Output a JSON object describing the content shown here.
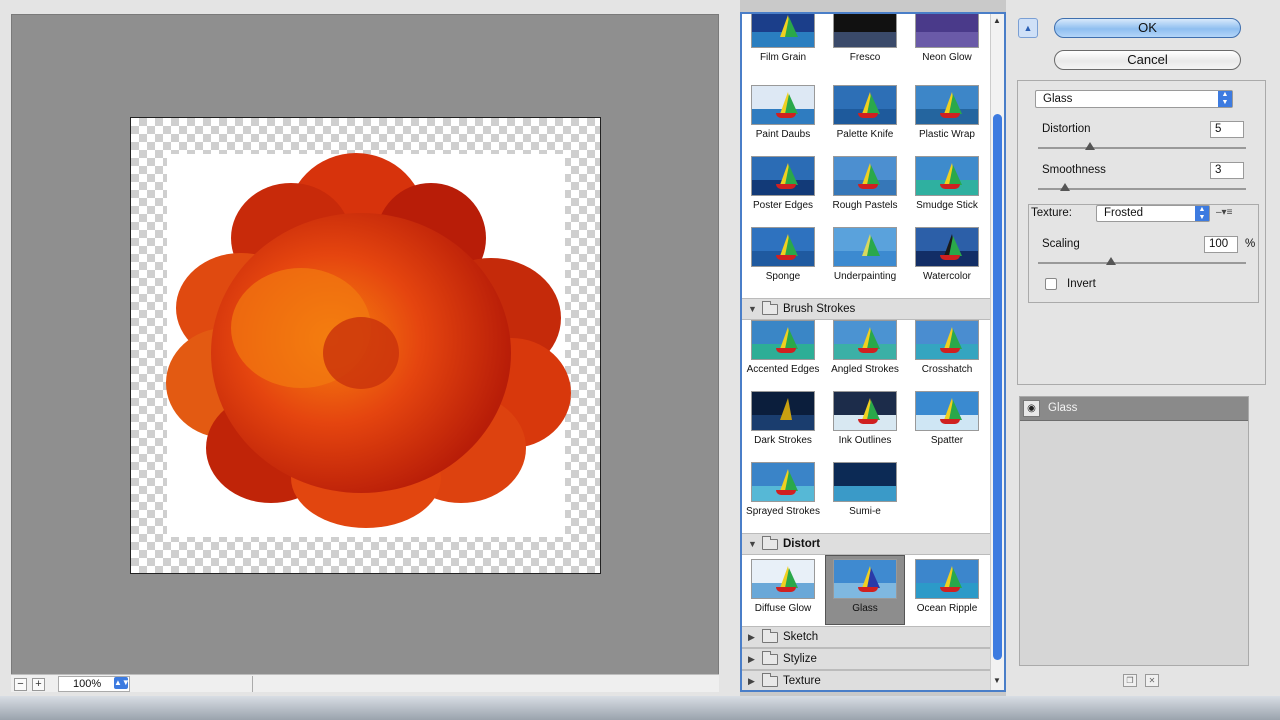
{
  "preview": {
    "zoom_value": "100%",
    "zoom_out_label": "−",
    "zoom_in_label": "+"
  },
  "gallery": {
    "rows_top": [
      [
        {
          "label": "Film Grain"
        },
        {
          "label": "Fresco"
        },
        {
          "label": "Neon Glow"
        }
      ],
      [
        {
          "label": "Paint Daubs"
        },
        {
          "label": "Palette Knife"
        },
        {
          "label": "Plastic Wrap"
        }
      ],
      [
        {
          "label": "Poster Edges"
        },
        {
          "label": "Rough Pastels"
        },
        {
          "label": "Smudge Stick"
        }
      ],
      [
        {
          "label": "Sponge"
        },
        {
          "label": "Underpainting"
        },
        {
          "label": "Watercolor"
        }
      ]
    ],
    "categories": {
      "brush_strokes": "Brush Strokes",
      "distort": "Distort",
      "sketch": "Sketch",
      "stylize": "Stylize",
      "texture": "Texture"
    },
    "brush_rows": [
      [
        {
          "label": "Accented Edges"
        },
        {
          "label": "Angled Strokes"
        },
        {
          "label": "Crosshatch"
        }
      ],
      [
        {
          "label": "Dark Strokes"
        },
        {
          "label": "Ink Outlines"
        },
        {
          "label": "Spatter"
        }
      ],
      [
        {
          "label": "Sprayed Strokes"
        },
        {
          "label": "Sumi-e"
        }
      ]
    ],
    "distort_row": [
      {
        "label": "Diffuse Glow"
      },
      {
        "label": "Glass"
      },
      {
        "label": "Ocean Ripple"
      }
    ],
    "selected": "Glass"
  },
  "settings": {
    "ok_label": "OK",
    "cancel_label": "Cancel",
    "filter_name": "Glass",
    "distortion_label": "Distortion",
    "distortion_value": "5",
    "distortion_fraction": 0.25,
    "smoothness_label": "Smoothness",
    "smoothness_value": "3",
    "smoothness_fraction": 0.13,
    "texture_label": "Texture:",
    "texture_value": "Frosted",
    "scaling_label": "Scaling",
    "scaling_value": "100",
    "scaling_fraction": 0.35,
    "scaling_unit": "%",
    "invert_label": "Invert"
  },
  "layers": {
    "active_layer": "Glass"
  },
  "colors": {
    "accent": "#3d7be0",
    "flower_dark": "#b81d08",
    "flower_mid": "#e5450f",
    "flower_light": "#f7840e"
  }
}
